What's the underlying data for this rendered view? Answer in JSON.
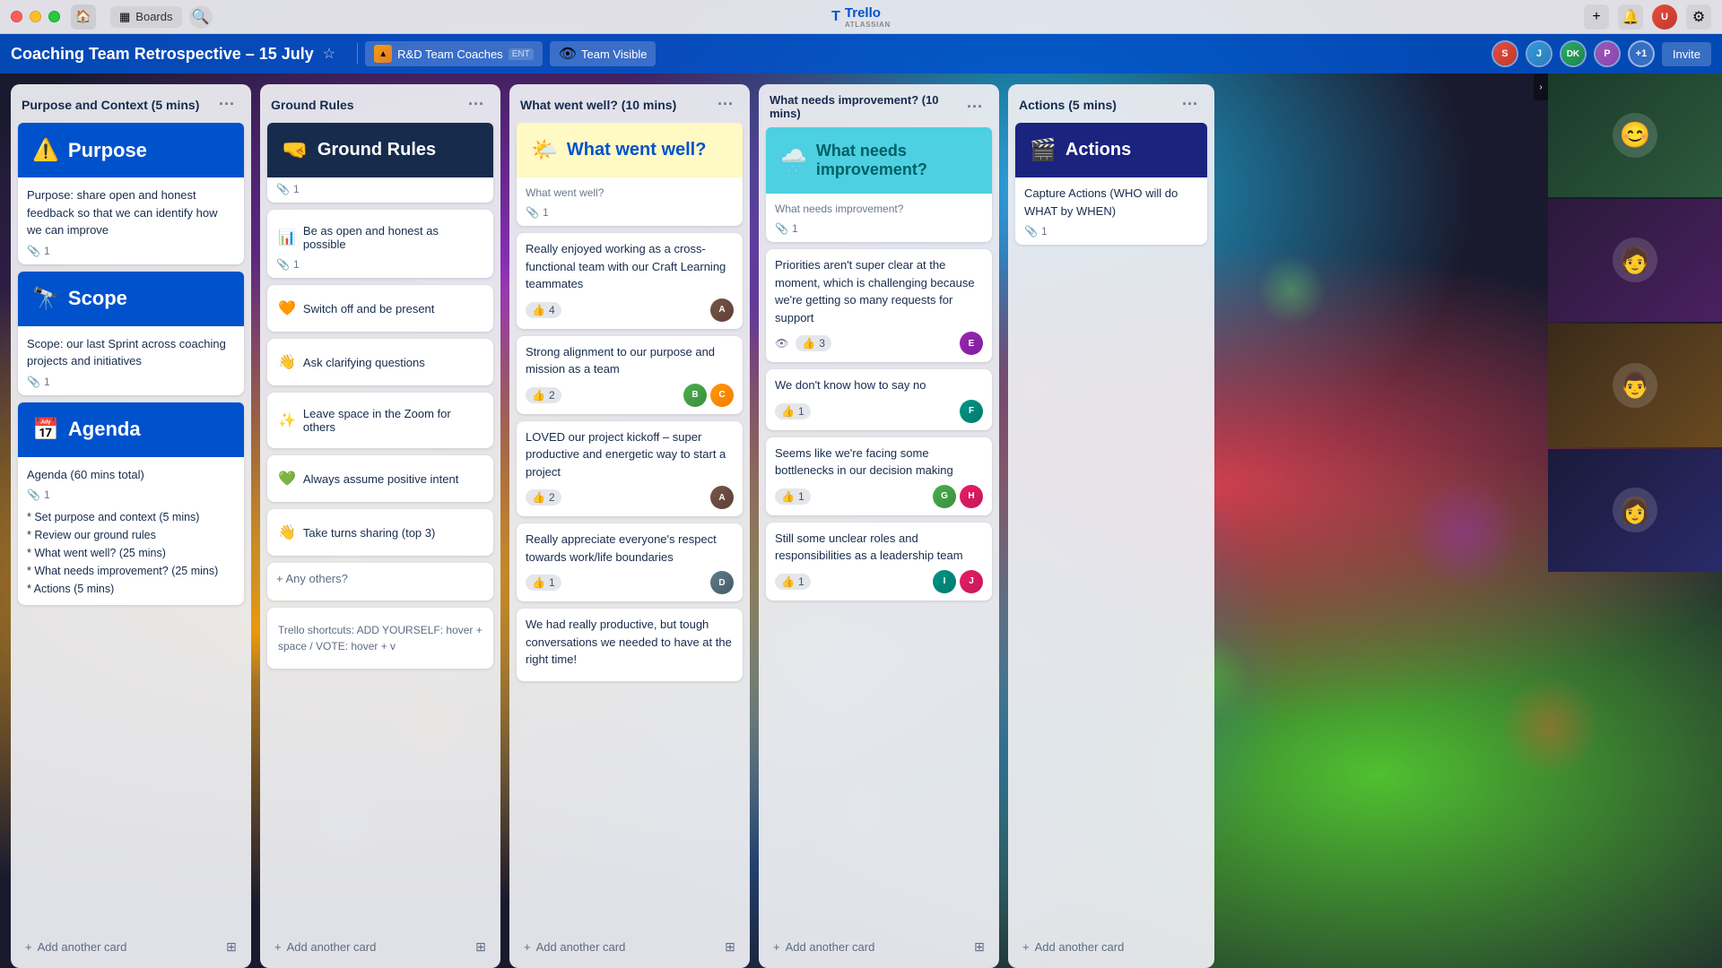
{
  "titlebar": {
    "traffic_lights": [
      "red",
      "yellow",
      "green"
    ],
    "nav_back": "‹",
    "nav_forward": "›",
    "home_icon": "🏠",
    "boards_icon": "▦",
    "boards_label": "Boards",
    "search_icon": "🔍",
    "trello_logo": "T Trello",
    "atlassian_label": "ATLASSIAN",
    "plus_icon": "+",
    "bell_icon": "🔔",
    "gear_icon": "⚙"
  },
  "appbar": {
    "board_title": "Coaching Team Retrospective – 15 July",
    "star_icon": "☆",
    "workspace_icon": "▲",
    "workspace_name": "R&D Team Coaches",
    "workspace_tag": "ENT",
    "visibility_icon": "👁",
    "visibility_label": "Team Visible",
    "invite_label": "Invite",
    "members": [
      {
        "id": "m1",
        "initials": "S",
        "class": "avatar-1"
      },
      {
        "id": "m2",
        "initials": "J",
        "class": "avatar-2"
      },
      {
        "id": "m3",
        "initials": "DK",
        "class": "avatar-dk"
      },
      {
        "id": "m4",
        "initials": "P",
        "class": "avatar-4"
      }
    ],
    "plus_count": "+1"
  },
  "lists": [
    {
      "id": "purpose-context",
      "title": "Purpose and Context (5 mins)",
      "cards": [
        {
          "id": "purpose",
          "banner": {
            "emoji": "⚠️",
            "title": "Purpose",
            "style": "blue",
            "titleColor": "white"
          },
          "body": "Purpose: share open and honest feedback so that we can identify how we can improve",
          "attachment_count": "1"
        },
        {
          "id": "scope",
          "banner": {
            "emoji": "🔭",
            "title": "Scope",
            "style": "blue",
            "titleColor": "white"
          },
          "body": "Scope: our last Sprint across coaching projects and initiatives",
          "attachment_count": "1"
        },
        {
          "id": "agenda",
          "banner": {
            "emoji": "📅",
            "title": "Agenda",
            "style": "blue",
            "titleColor": "white"
          },
          "body": "Agenda (60 mins total)",
          "attachment_count": "1",
          "agenda_items": [
            "* Set purpose and context (5 mins)",
            "* Review our ground rules",
            "* What went well? (25 mins)",
            "* What needs improvement? (25 mins)",
            "* Actions (5 mins)"
          ]
        }
      ],
      "add_card_label": "+ Add another card"
    },
    {
      "id": "ground-rules",
      "title": "Ground Rules",
      "cards": [
        {
          "id": "ground-rules-header",
          "banner": {
            "emoji": "🤜",
            "title": "Ground Rules",
            "style": "dark",
            "titleColor": "white"
          },
          "attachment_count": "1",
          "body": null
        },
        {
          "id": "rule-open",
          "body": "Be as open and honest as possible",
          "emoji": "📊",
          "attachment_count": "1"
        },
        {
          "id": "rule-switch",
          "body": "Switch off and be present",
          "emoji": "🧡"
        },
        {
          "id": "rule-ask",
          "body": "Ask clarifying questions",
          "emoji": "👋"
        },
        {
          "id": "rule-leave",
          "body": "Leave space in the Zoom for others",
          "emoji": "✨"
        },
        {
          "id": "rule-positive",
          "body": "Always assume positive intent",
          "emoji": "💚"
        },
        {
          "id": "rule-turns",
          "body": "Take turns sharing (top 3)",
          "emoji": "👋"
        },
        {
          "id": "rule-others",
          "body": "+ Any others?"
        },
        {
          "id": "rule-shortcuts",
          "body": "Trello shortcuts: ADD YOURSELF: hover + space / VOTE: hover + v",
          "is_shortcut": true
        }
      ],
      "add_card_label": "+ Add another card"
    },
    {
      "id": "what-went-well",
      "title": "What went well? (10 mins)",
      "cards": [
        {
          "id": "wwwell-header",
          "banner": {
            "emoji": "🌤️",
            "title": "What went well?",
            "style": "yellow",
            "titleColor": "blue"
          },
          "body": "What went well?",
          "attachment_count": "1"
        },
        {
          "id": "wwwell-1",
          "body": "Really enjoyed working as a cross-functional team with our Craft Learning teammates",
          "votes": "4",
          "votes_active": false,
          "avatars": [
            {
              "class": "ca-brown",
              "initials": "A"
            }
          ]
        },
        {
          "id": "wwwell-2",
          "body": "Strong alignment to our purpose and mission as a team",
          "votes": "2",
          "votes_active": false,
          "avatars": [
            {
              "class": "ca-green",
              "initials": "B"
            },
            {
              "class": "ca-orange",
              "initials": "C"
            }
          ]
        },
        {
          "id": "wwwell-3",
          "body": "LOVED our project kickoff – super productive and energetic way to start a project",
          "votes": "2",
          "votes_active": false,
          "avatars": [
            {
              "class": "ca-brown",
              "initials": "A"
            }
          ]
        },
        {
          "id": "wwwell-4",
          "body": "Really appreciate everyone's respect towards work/life boundaries",
          "votes": "1",
          "votes_active": false,
          "avatars": [
            {
              "class": "ca-gray",
              "initials": "D"
            }
          ]
        },
        {
          "id": "wwwell-5",
          "body": "We had really productive, but tough conversations we needed to have at the right time!"
        }
      ],
      "add_card_label": "+ Add another card"
    },
    {
      "id": "needs-improvement",
      "title": "What needs improvement? (10 mins)",
      "cards": [
        {
          "id": "improvement-header",
          "banner": {
            "emoji": "🌧️",
            "title": "What needs improvement?",
            "style": "teal",
            "titleColor": "dark"
          },
          "body": "What needs improvement?",
          "attachment_count": "1"
        },
        {
          "id": "improvement-1",
          "body": "Priorities aren't super clear at the moment, which is challenging because we're getting so many requests for support",
          "votes": "3",
          "votes_active": false,
          "has_views": true,
          "avatars": [
            {
              "class": "ca-purple",
              "initials": "E"
            }
          ]
        },
        {
          "id": "improvement-2",
          "body": "We don't know how to say no",
          "votes": "1",
          "votes_active": false,
          "avatars": [
            {
              "class": "ca-teal",
              "initials": "F"
            }
          ]
        },
        {
          "id": "improvement-3",
          "body": "Seems like we're facing some bottlenecks in our decision making",
          "votes": "1",
          "votes_active": false,
          "avatars": [
            {
              "class": "ca-green",
              "initials": "G"
            },
            {
              "class": "ca-pink",
              "initials": "H"
            }
          ]
        },
        {
          "id": "improvement-4",
          "body": "Still some unclear roles and responsibilities as a leadership team",
          "votes": "1",
          "votes_active": false,
          "avatars": [
            {
              "class": "ca-teal",
              "initials": "I"
            },
            {
              "class": "ca-pink",
              "initials": "J"
            }
          ]
        }
      ],
      "add_card_label": "+ Add another card"
    },
    {
      "id": "actions",
      "title": "Actions (5 mins)",
      "cards": [
        {
          "id": "actions-header",
          "banner": {
            "emoji": "🎬",
            "title": "Actions",
            "style": "navy",
            "titleColor": "white"
          },
          "body": "Capture Actions (WHO will do WHAT by WHEN)",
          "attachment_count": "1"
        }
      ],
      "add_card_label": "+ Add another card"
    }
  ],
  "video_panel": {
    "tiles": [
      {
        "id": "vt1",
        "bg_class": "vt1",
        "emoji": "😊"
      },
      {
        "id": "vt2",
        "bg_class": "vt2",
        "emoji": "🧑"
      },
      {
        "id": "vt3",
        "bg_class": "vt3",
        "emoji": "👨"
      },
      {
        "id": "vt4",
        "bg_class": "vt4",
        "emoji": "👩"
      }
    ],
    "collapse_icon": "›"
  },
  "icons": {
    "attachment": "📎",
    "thumbup": "👍",
    "eye": "👁",
    "plus": "+",
    "template": "⊞",
    "more": "···"
  }
}
